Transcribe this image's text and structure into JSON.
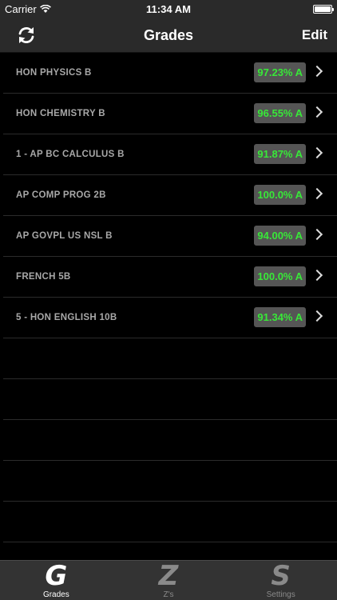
{
  "status_bar": {
    "carrier": "Carrier",
    "time": "11:34 AM",
    "battery_level_percent": 100,
    "wifi_icon": "wifi-icon",
    "battery_icon": "battery-icon"
  },
  "nav": {
    "title": "Grades",
    "edit_label": "Edit",
    "refresh_icon": "refresh-icon"
  },
  "courses": [
    {
      "name": "HON PHYSICS B",
      "grade": "97.23% A"
    },
    {
      "name": "HON CHEMISTRY B",
      "grade": "96.55% A"
    },
    {
      "name": "1 - AP BC CALCULUS B",
      "grade": "91.87% A"
    },
    {
      "name": "AP COMP PROG 2B",
      "grade": "100.0% A"
    },
    {
      "name": "AP GOVPL US NSL B",
      "grade": "94.00% A"
    },
    {
      "name": "FRENCH 5B",
      "grade": "100.0% A"
    },
    {
      "name": "5 - HON ENGLISH 10B",
      "grade": "91.34% A"
    }
  ],
  "tabs": [
    {
      "icon": "G",
      "label": "Grades",
      "active": true
    },
    {
      "icon": "Z",
      "label": "Z's",
      "active": false
    },
    {
      "icon": "S",
      "label": "Settings",
      "active": false
    }
  ],
  "colors": {
    "grade_text": "#38e838",
    "badge_bg": "#555555",
    "bar_bg": "#2a2a2a"
  }
}
